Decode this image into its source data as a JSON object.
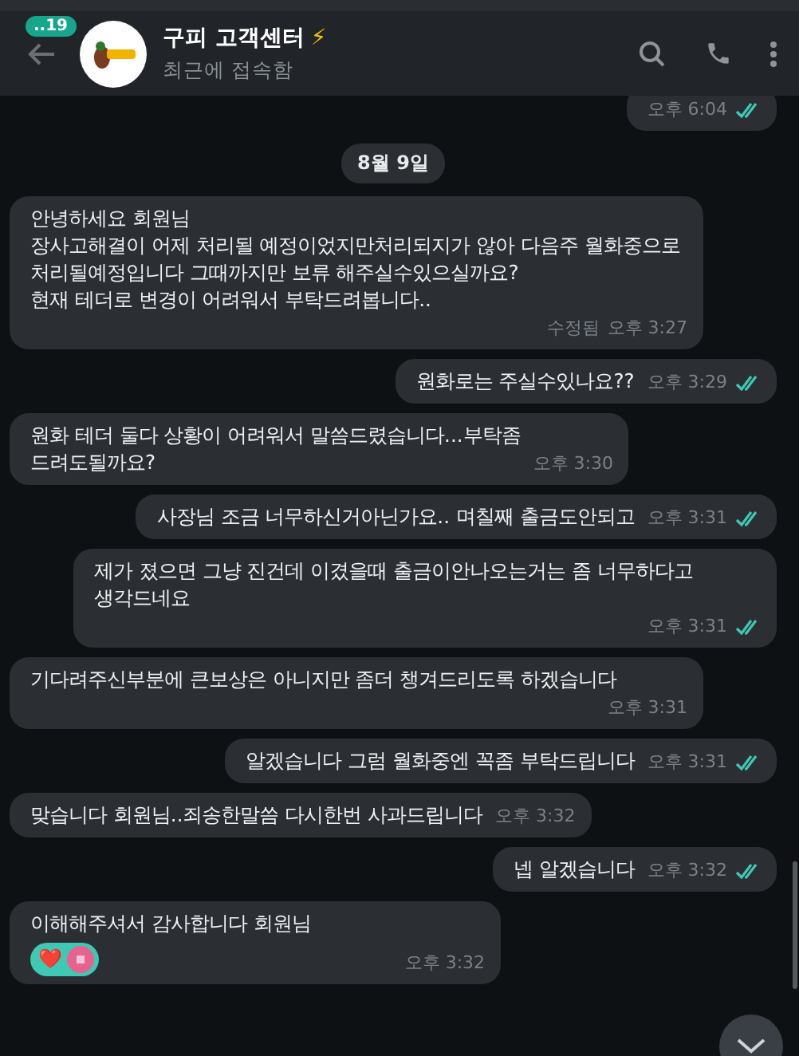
{
  "header": {
    "unread_badge": "..19",
    "title": "구피 고객센터",
    "title_emoji": "⚡",
    "status": "최근에 접속함"
  },
  "messages": [
    {
      "kind": "message",
      "outgoing": true,
      "time": "오후 6:04",
      "read": true
    },
    {
      "kind": "date",
      "text": "8월 9일"
    },
    {
      "kind": "message",
      "outgoing": false,
      "text": "안녕하세요 회원님\n장사고해결이 어제 처리될 예정이었지만처리되지가 않아 다음주 월화중으로 처리될예정입니다 그때까지만 보류 해주실수있으실까요?\n현재 테더로 변경이 어려워서 부탁드려봅니다..",
      "edited": "수정됨",
      "time": "오후 3:27"
    },
    {
      "kind": "message",
      "outgoing": true,
      "text": "원화로는 주실수있나요??",
      "time": "오후 3:29",
      "read": true
    },
    {
      "kind": "message",
      "outgoing": false,
      "text": "원화 테더 둘다 상황이 어려워서 말씀드렸습니다...부탁좀\n드려도될까요?",
      "time": "오후 3:30"
    },
    {
      "kind": "message",
      "outgoing": true,
      "text": "사장님 조금 너무하신거아닌가요.. 며칠째 출금도안되고",
      "time": "오후 3:31",
      "read": true
    },
    {
      "kind": "message",
      "outgoing": true,
      "text": "제가 졌으면 그냥 진건데 이겼을때 출금이안나오는거는 좀 너무하다고\n생각드네요",
      "time": "오후 3:31",
      "read": true
    },
    {
      "kind": "message",
      "outgoing": false,
      "text": "기다려주신부분에 큰보상은 아니지만 좀더 챙겨드리도록 하겠습니다",
      "time": "오후 3:31"
    },
    {
      "kind": "message",
      "outgoing": true,
      "text": "알겠습니다 그럼 월화중엔 꼭좀 부탁드립니다",
      "time": "오후 3:31",
      "read": true
    },
    {
      "kind": "message",
      "outgoing": false,
      "text": "맞습니다 회원님..죄송한말씀 다시한번 사과드립니다",
      "time": "오후 3:32"
    },
    {
      "kind": "message",
      "outgoing": true,
      "text": "넵 알겠습니다",
      "time": "오후 3:32",
      "read": true
    },
    {
      "kind": "message",
      "outgoing": false,
      "text": "이해해주셔서 감사합니다 회원님",
      "time": "오후 3:32",
      "reaction": "❤️"
    }
  ]
}
